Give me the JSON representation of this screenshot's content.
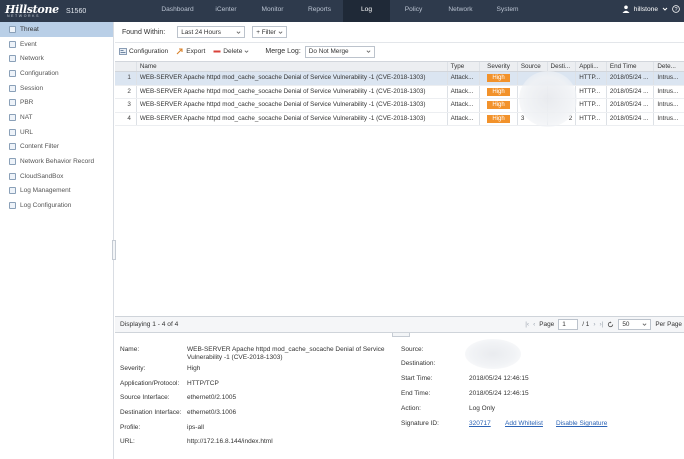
{
  "brand": {
    "logo": "Hillstone",
    "logo_sub": "NETWORKS",
    "model": "S1560"
  },
  "nav": [
    {
      "label": "Dashboard",
      "active": false
    },
    {
      "label": "iCenter",
      "active": false
    },
    {
      "label": "Monitor",
      "active": false
    },
    {
      "label": "Reports",
      "active": false
    },
    {
      "label": "Log",
      "active": true
    },
    {
      "label": "Policy",
      "active": false
    },
    {
      "label": "Network",
      "active": false
    },
    {
      "label": "System",
      "active": false
    }
  ],
  "user": {
    "name": "hillstone"
  },
  "sidebar": {
    "items": [
      {
        "label": "Threat",
        "active": true
      },
      {
        "label": "Event",
        "active": false
      },
      {
        "label": "Network",
        "active": false
      },
      {
        "label": "Configuration",
        "active": false
      },
      {
        "label": "Session",
        "active": false
      },
      {
        "label": "PBR",
        "active": false
      },
      {
        "label": "NAT",
        "active": false
      },
      {
        "label": "URL",
        "active": false
      },
      {
        "label": "Content Filter",
        "active": false
      },
      {
        "label": "Network Behavior Record",
        "active": false
      },
      {
        "label": "CloudSandBox",
        "active": false
      },
      {
        "label": "Log Management",
        "active": false
      },
      {
        "label": "Log Configuration",
        "active": false
      }
    ]
  },
  "filter": {
    "found_within_label": "Found Within:",
    "found_within_value": "Last 24 Hours",
    "filter_button": "+ Filter"
  },
  "toolbar": {
    "configuration": "Configuration",
    "export": "Export",
    "delete": "Delete",
    "merge_log_label": "Merge Log:",
    "merge_log_value": "Do Not Merge"
  },
  "grid": {
    "headers": [
      "Name",
      "Type",
      "Severity",
      "Source",
      "Desti...",
      "Appli...",
      "End Time",
      "Dete..."
    ],
    "rows": [
      {
        "n": "1",
        "name": "WEB-SERVER Apache httpd mod_cache_socache Denial of Service Vulnerability -1 (CVE-2018-1303)",
        "type": "Attack...",
        "severity": "High",
        "source": "",
        "dest": "",
        "app": "HTTP...",
        "end_time": "2018/05/24 ...",
        "detect": "Intrus...",
        "selected": true
      },
      {
        "n": "2",
        "name": "WEB-SERVER Apache httpd mod_cache_socache Denial of Service Vulnerability -1 (CVE-2018-1303)",
        "type": "Attack...",
        "severity": "High",
        "source": "",
        "dest": "",
        "app": "HTTP...",
        "end_time": "2018/05/24 ...",
        "detect": "Intrus...",
        "selected": false
      },
      {
        "n": "3",
        "name": "WEB-SERVER Apache httpd mod_cache_socache Denial of Service Vulnerability -1 (CVE-2018-1303)",
        "type": "Attack...",
        "severity": "High",
        "source": "",
        "dest": "",
        "app": "HTTP...",
        "end_time": "2018/05/24 ...",
        "detect": "Intrus...",
        "selected": false
      },
      {
        "n": "4",
        "name": "WEB-SERVER Apache httpd mod_cache_socache Denial of Service Vulnerability -1 (CVE-2018-1303)",
        "type": "Attack...",
        "severity": "High",
        "source": "3",
        "dest": "2",
        "app": "HTTP...",
        "end_time": "2018/05/24 ...",
        "detect": "Intrus...",
        "selected": false
      }
    ]
  },
  "pager": {
    "displaying": "Displaying 1 - 4 of 4",
    "page_label": "Page",
    "page_value": "1",
    "page_total": "/ 1",
    "page_size": "50",
    "per_page": "Per Page"
  },
  "detail": {
    "name_label": "Name:",
    "name_value": "WEB-SERVER Apache httpd mod_cache_socache Denial of Service Vulnerability -1 (CVE-2018-1303)",
    "severity_label": "Severity:",
    "severity_value": "High",
    "app_label": "Application/Protocol:",
    "app_value": "HTTP/TCP",
    "src_if_label": "Source Interface:",
    "src_if_value": "ethernet0/2.1005",
    "dst_if_label": "Destination Interface:",
    "dst_if_value": "ethernet0/3.1006",
    "profile_label": "Profile:",
    "profile_value": "ips-all",
    "url_label": "URL:",
    "url_value": "http://172.16.8.144/index.html",
    "source_label": "Source:",
    "source_value": "",
    "destination_label": "Destination:",
    "destination_value": "",
    "start_time_label": "Start Time:",
    "start_time_value": "2018/05/24 12:46:15",
    "end_time_label": "End Time:",
    "end_time_value": "2018/05/24 12:46:15",
    "action_label": "Action:",
    "action_value": "Log Only",
    "signature_label": "Signature ID:",
    "signature_value": "320717",
    "add_whitelist": "Add Whitelist",
    "disable_signature": "Disable Signature"
  },
  "colors": {
    "topbar": "#2e3a4c",
    "active_nav": "#1f2937",
    "sidebar_active": "#b9cfe7",
    "severity_high": "#f2922b",
    "link": "#2b63b5"
  }
}
